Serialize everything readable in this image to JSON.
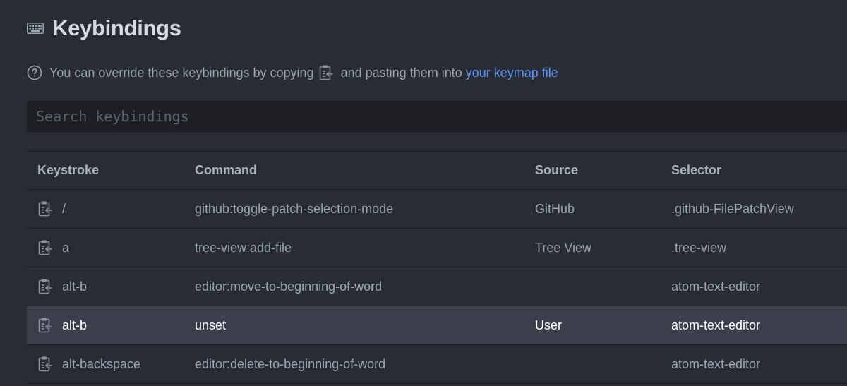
{
  "header": {
    "title": "Keybindings",
    "icon": "keyboard-icon"
  },
  "info": {
    "text_before": "You can override these keybindings by copying",
    "text_after": "and pasting them into",
    "link": "your keymap file"
  },
  "search": {
    "placeholder": "Search keybindings",
    "value": ""
  },
  "table": {
    "columns": [
      "Keystroke",
      "Command",
      "Source",
      "Selector"
    ],
    "rows": [
      {
        "keystroke": "/",
        "command": "github:toggle-patch-selection-mode",
        "source": "GitHub",
        "selector": ".github-FilePatchView"
      },
      {
        "keystroke": "a",
        "command": "tree-view:add-file",
        "source": "Tree View",
        "selector": ".tree-view"
      },
      {
        "keystroke": "alt-b",
        "command": "editor:move-to-beginning-of-word",
        "source": "",
        "selector": "atom-text-editor"
      },
      {
        "keystroke": "alt-b",
        "command": "unset",
        "source": "User",
        "selector": "atom-text-editor"
      },
      {
        "keystroke": "alt-backspace",
        "command": "editor:delete-to-beginning-of-word",
        "source": "",
        "selector": "atom-text-editor"
      }
    ]
  },
  "colors": {
    "background": "#282c34",
    "link": "#6494ed",
    "highlight_row": "#3a3f4b",
    "search_bg": "#1d1f23"
  }
}
